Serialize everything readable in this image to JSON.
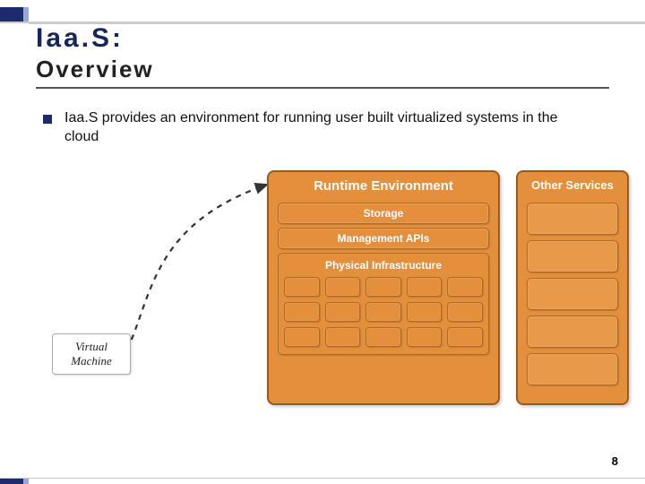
{
  "title": "Iaa.S:",
  "subtitle": "Overview",
  "bullet_text": "Iaa.S provides an environment for running user built virtualized systems in the cloud",
  "vm_label_line1": "Virtual",
  "vm_label_line2": "Machine",
  "runtime_panel": {
    "header": "Runtime Environment",
    "storage": "Storage",
    "mgmt": "Management APIs",
    "phys": "Physical Infrastructure"
  },
  "other_panel": {
    "header": "Other Services"
  },
  "page_number": "8",
  "colors": {
    "accent_navy": "#1d2a6c",
    "panel_orange": "#e38f3c",
    "panel_border": "#9a5a1e"
  }
}
